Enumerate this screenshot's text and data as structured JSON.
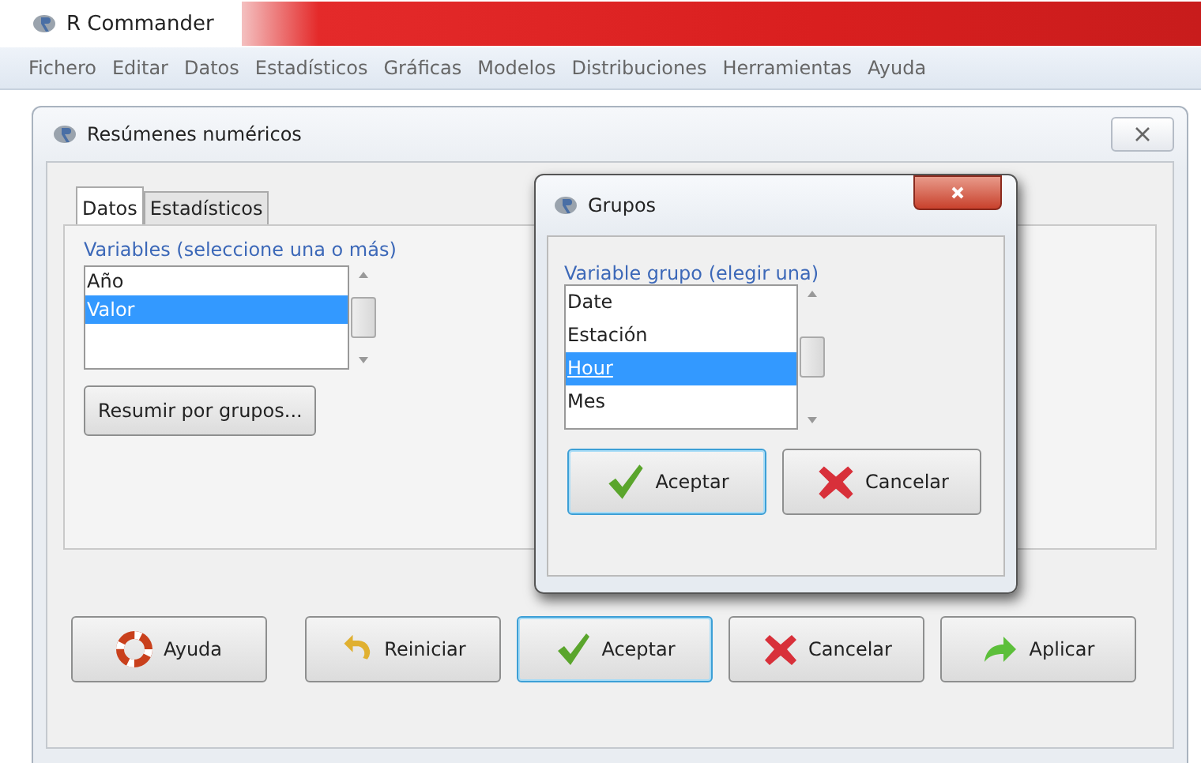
{
  "app": {
    "title": "R Commander"
  },
  "menu": [
    "Fichero",
    "Editar",
    "Datos",
    "Estadísticos",
    "Gráficas",
    "Modelos",
    "Distribuciones",
    "Herramientas",
    "Ayuda"
  ],
  "dialog": {
    "title": "Resúmenes numéricos",
    "tabs": [
      {
        "label": "Datos",
        "selected": true
      },
      {
        "label": "Estadísticos",
        "selected": false
      }
    ],
    "variables": {
      "label": "Variables (seleccione una o más)",
      "items": [
        {
          "label": "Año",
          "selected": false
        },
        {
          "label": "Valor",
          "selected": true
        }
      ]
    },
    "group_button": "Resumir por grupos...",
    "buttons": [
      {
        "label": "Ayuda",
        "kind": "help",
        "focused": false
      },
      {
        "label": "Reiniciar",
        "kind": "reset",
        "focused": false
      },
      {
        "label": "Aceptar",
        "kind": "ok",
        "focused": true
      },
      {
        "label": "Cancelar",
        "kind": "cancel",
        "focused": false
      },
      {
        "label": "Aplicar",
        "kind": "apply",
        "focused": false
      }
    ]
  },
  "groups_dialog": {
    "title": "Grupos",
    "label": "Variable grupo (elegir una)",
    "items": [
      {
        "label": "Date",
        "selected": false
      },
      {
        "label": "Estación",
        "selected": false
      },
      {
        "label": "Hour",
        "selected": true
      },
      {
        "label": "Mes",
        "selected": false
      }
    ],
    "buttons": [
      {
        "label": "Aceptar",
        "kind": "ok",
        "focused": true
      },
      {
        "label": "Cancelar",
        "kind": "cancel",
        "focused": false
      }
    ]
  }
}
